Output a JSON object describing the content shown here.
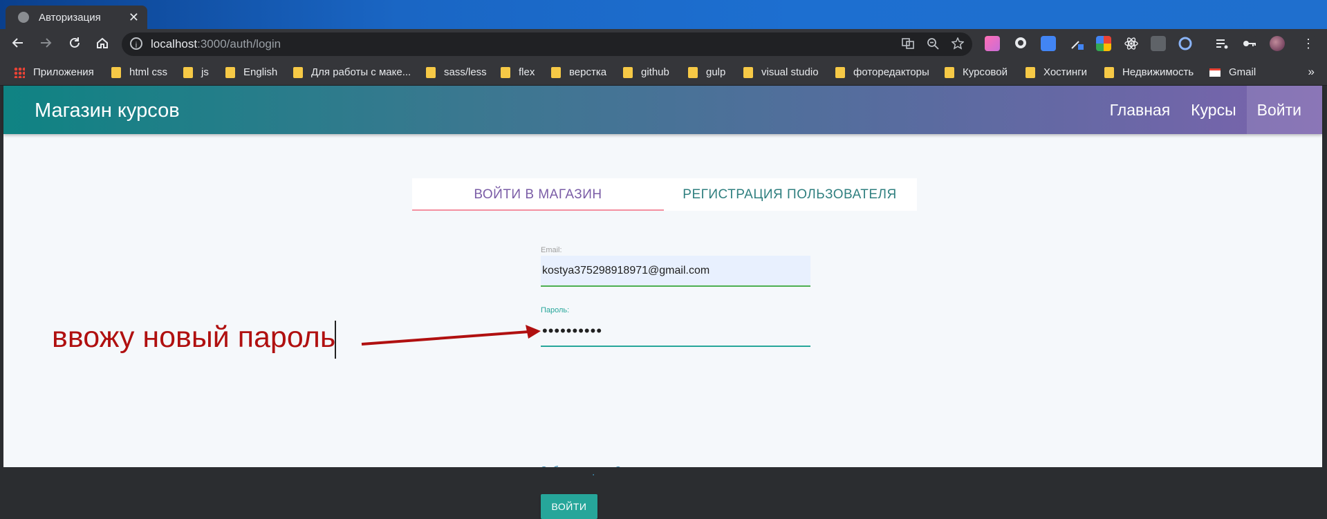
{
  "browser": {
    "tab_title": "Авторизация",
    "tab_close": "✕",
    "url_host": "localhost",
    "url_rest": ":3000/auth/login"
  },
  "bookmarks": [
    {
      "label": "Приложения",
      "type": "apps"
    },
    {
      "label": "html css",
      "type": "folder"
    },
    {
      "label": "js",
      "type": "folder"
    },
    {
      "label": "English",
      "type": "folder"
    },
    {
      "label": "Для работы с маке...",
      "type": "folder"
    },
    {
      "label": "sass/less",
      "type": "folder"
    },
    {
      "label": "flex",
      "type": "folder"
    },
    {
      "label": "верстка",
      "type": "folder"
    },
    {
      "label": "github",
      "type": "folder"
    },
    {
      "label": "gulp",
      "type": "folder"
    },
    {
      "label": "visual studio",
      "type": "folder"
    },
    {
      "label": "фоторедакторы",
      "type": "folder"
    },
    {
      "label": "Курсовой",
      "type": "folder"
    },
    {
      "label": "Хостинги",
      "type": "folder"
    },
    {
      "label": "Недвижимость",
      "type": "folder"
    },
    {
      "label": "Gmail",
      "type": "gmail"
    }
  ],
  "site": {
    "brand": "Магазин курсов",
    "nav": [
      "Главная",
      "Курсы",
      "Войти"
    ]
  },
  "auth": {
    "tab_login": "ВОЙТИ В МАГАЗИН",
    "tab_register": "РЕГИСТРАЦИЯ ПОЛЬЗОВАТЕЛЯ",
    "email_label": "Email:",
    "email_value": "kostya375298918971@gmail.com",
    "password_label": "Пароль:",
    "password_value": "••••••••••",
    "forgot": "Забыли пароль?",
    "submit": "ВОЙТИ"
  },
  "annotation": {
    "text": "ввожу новый пароль",
    "color": "#b01010"
  }
}
